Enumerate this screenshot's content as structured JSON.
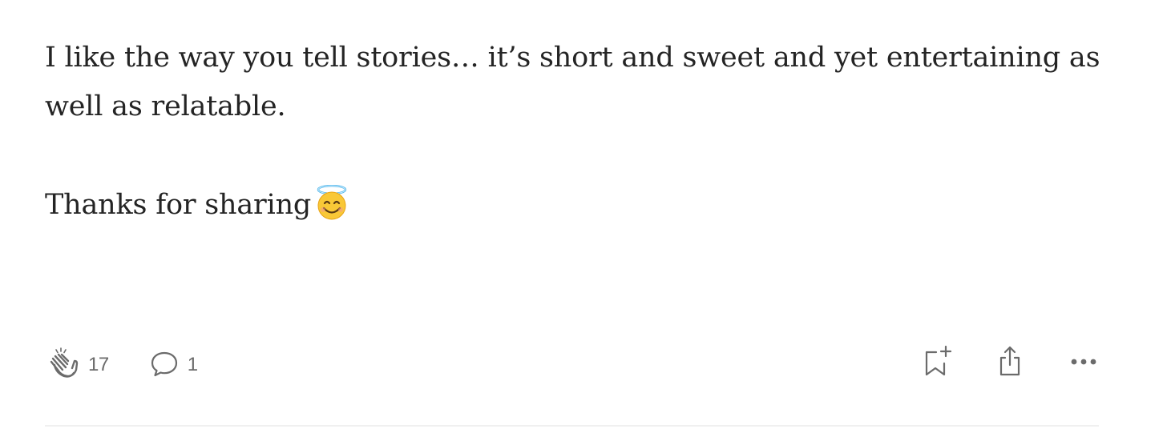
{
  "response": {
    "paragraph_1": "I like the way you tell stories… it’s short and sweet and yet entertaining as well as relatable.",
    "paragraph_2": "Thanks for sharing"
  },
  "actions": {
    "clap_count": "17",
    "reply_count": "1"
  },
  "icons": {
    "emoji": "smiling-face-with-halo-icon",
    "clap": "clap-icon",
    "reply": "speech-bubble-icon",
    "bookmark": "bookmark-add-icon",
    "share": "share-icon",
    "more": "more-dots-icon"
  },
  "colors": {
    "text": "#242424",
    "muted": "#6b6b6b",
    "divider": "#f0f0f0"
  }
}
